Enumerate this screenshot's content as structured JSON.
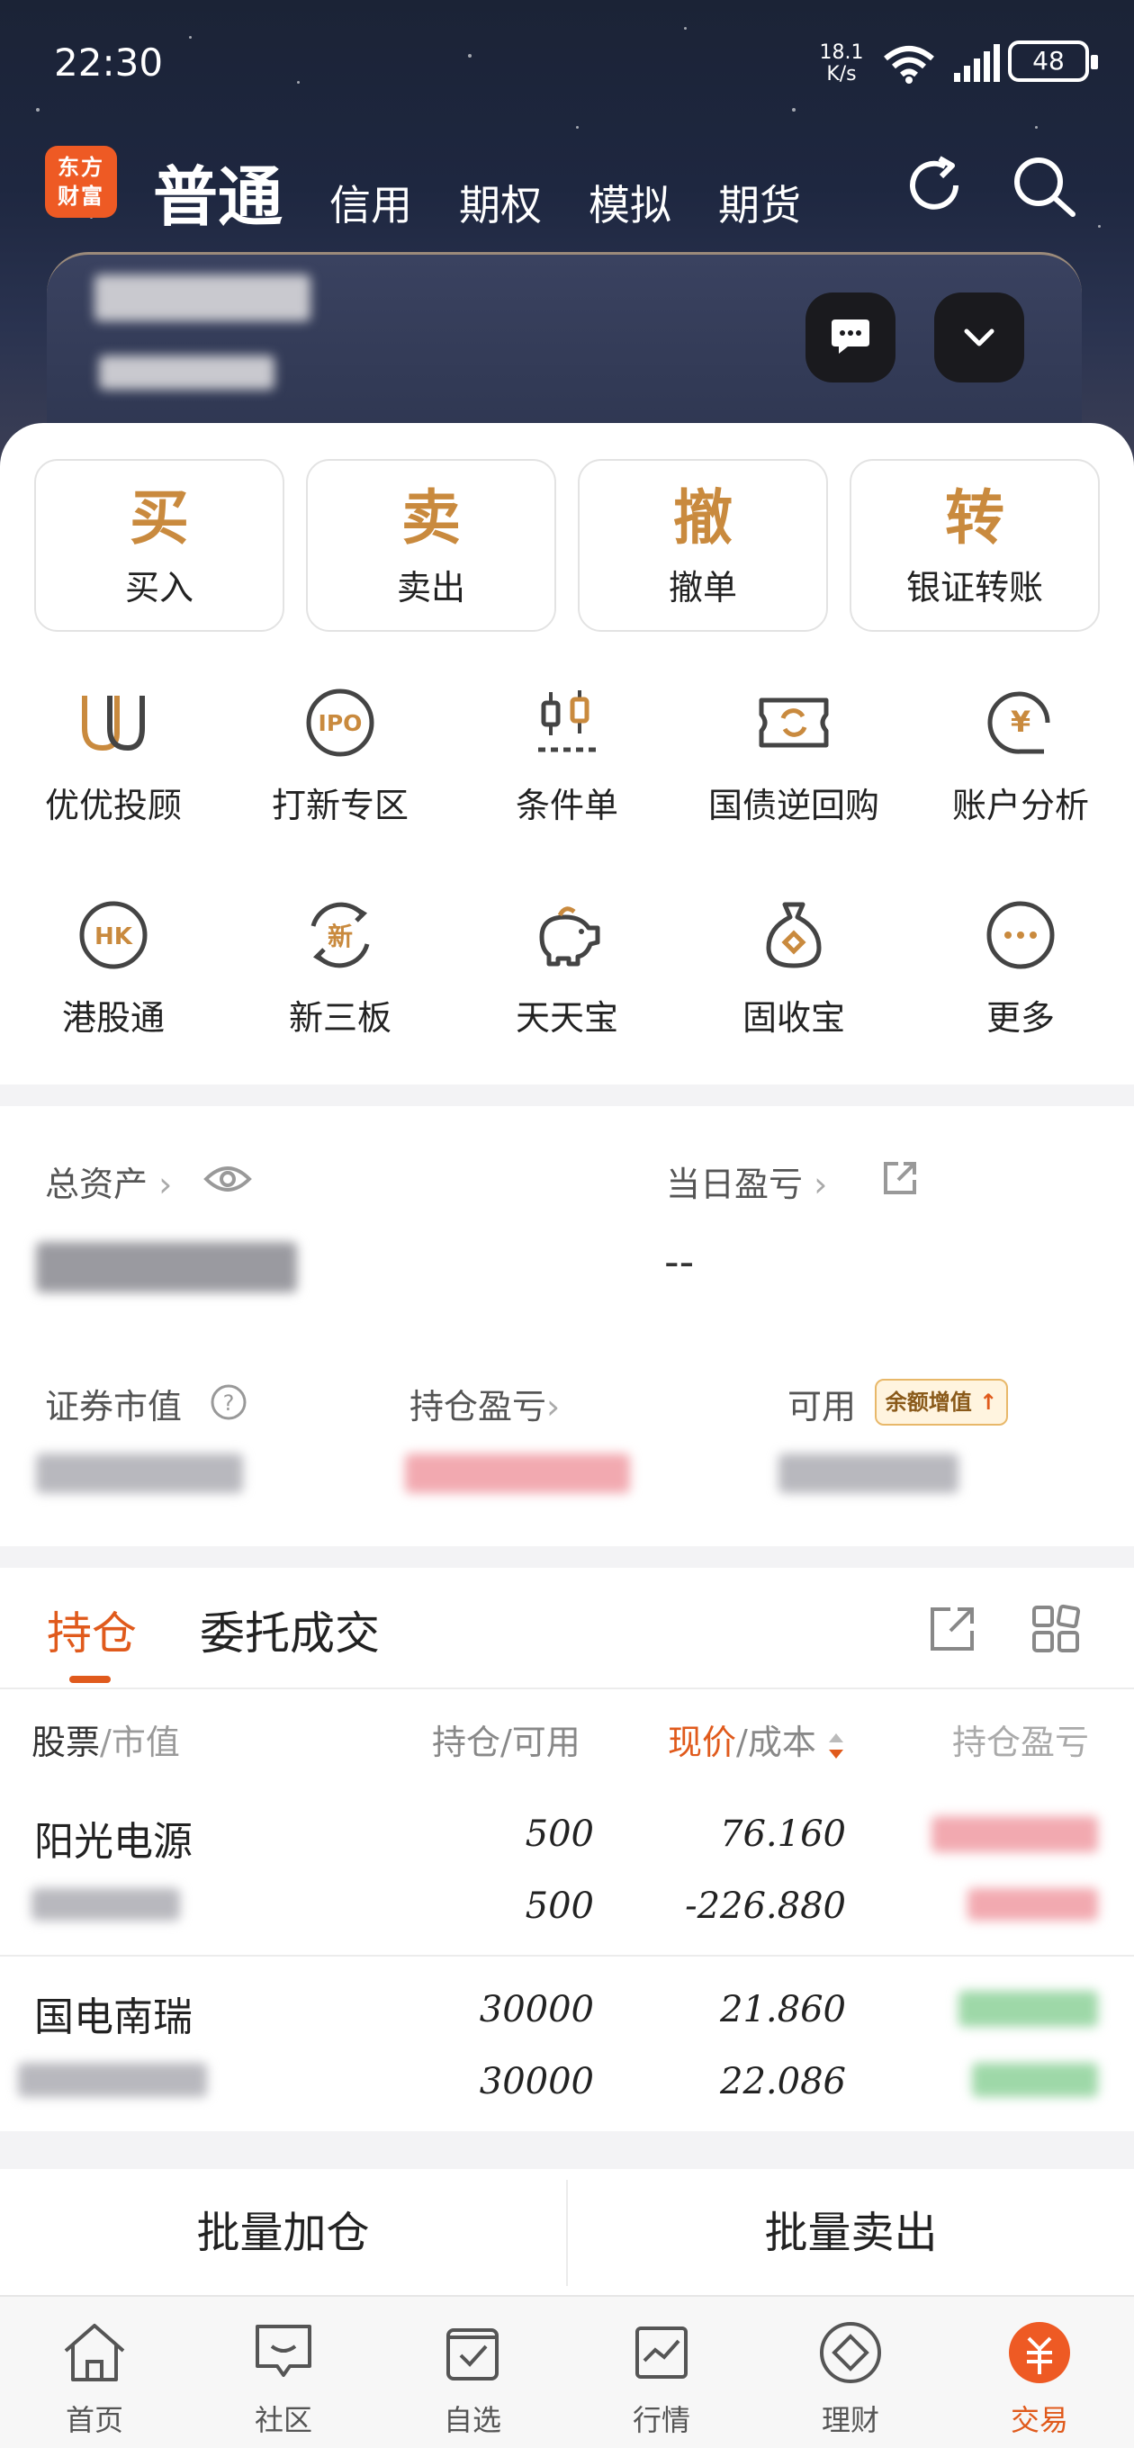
{
  "status_bar": {
    "time": "22:30",
    "net_speed_value": "18.1",
    "net_speed_unit": "K/s",
    "battery": "48"
  },
  "header": {
    "logo": "东方财富",
    "tabs": [
      {
        "label": "普通",
        "active": true
      },
      {
        "label": "信用"
      },
      {
        "label": "期权"
      },
      {
        "label": "模拟"
      },
      {
        "label": "期货"
      }
    ]
  },
  "quick_actions": [
    {
      "big": "买",
      "small": "买入"
    },
    {
      "big": "卖",
      "small": "卖出"
    },
    {
      "big": "撤",
      "small": "撤单"
    },
    {
      "big": "转",
      "small": "银证转账"
    }
  ],
  "services": [
    {
      "label": "优优投顾",
      "icon": "uu-advisor-icon"
    },
    {
      "label": "打新专区",
      "icon": "ipo-icon",
      "icon_text": "IPO"
    },
    {
      "label": "条件单",
      "icon": "condition-order-icon"
    },
    {
      "label": "国债逆回购",
      "icon": "reverse-repo-icon"
    },
    {
      "label": "账户分析",
      "icon": "account-analysis-icon",
      "icon_text": "¥"
    },
    {
      "label": "港股通",
      "icon": "hk-connect-icon",
      "icon_text": "HK"
    },
    {
      "label": "新三板",
      "icon": "neeq-icon",
      "icon_text": "新"
    },
    {
      "label": "天天宝",
      "icon": "piggy-bank-icon"
    },
    {
      "label": "固收宝",
      "icon": "money-bag-icon"
    },
    {
      "label": "更多",
      "icon": "more-icon"
    }
  ],
  "assets": {
    "total_label": "总资产",
    "daily_pnl_label": "当日盈亏",
    "daily_pnl_value": "--",
    "market_value_label": "证券市值",
    "position_pnl_label": "持仓盈亏",
    "available_label": "可用",
    "badge": "余额增值"
  },
  "positions": {
    "tabs": [
      "持仓",
      "委托成交"
    ],
    "headers": {
      "stock": "股票",
      "mv": "/市值",
      "qty": "持仓/可用",
      "price": "现价",
      "cost": "/成本",
      "pnl": "持仓盈亏"
    },
    "rows": [
      {
        "name": "阳光电源",
        "qty": "500",
        "avail": "500",
        "price": "76.160",
        "cost": "-226.880"
      },
      {
        "name": "国电南瑞",
        "qty": "30000",
        "avail": "30000",
        "price": "21.860",
        "cost": "22.086"
      }
    ],
    "actions": [
      "批量加仓",
      "批量卖出"
    ]
  },
  "bottom_nav": [
    {
      "label": "首页",
      "icon": "home-icon"
    },
    {
      "label": "社区",
      "icon": "community-icon"
    },
    {
      "label": "自选",
      "icon": "watchlist-icon"
    },
    {
      "label": "行情",
      "icon": "market-icon"
    },
    {
      "label": "理财",
      "icon": "wealth-icon"
    },
    {
      "label": "交易",
      "icon": "trade-icon",
      "active": true
    }
  ],
  "colors": {
    "accent": "#e05a1c",
    "gold": "#c98a3e",
    "icon": "#444444"
  }
}
